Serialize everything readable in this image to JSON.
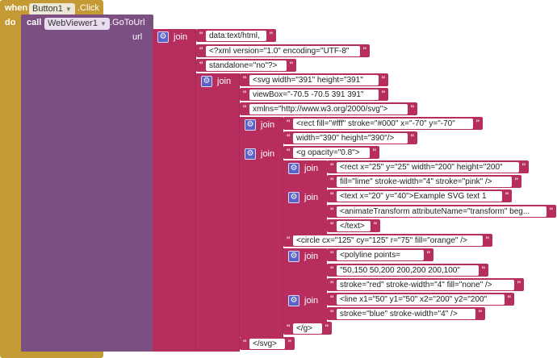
{
  "event": {
    "when": "when",
    "component": "Button1",
    "event_name": ".Click",
    "do": "do"
  },
  "call": {
    "keyword": "call",
    "component": "WebViewer1",
    "method": ".GoToUrl",
    "param": "url"
  },
  "join_label": "join",
  "strings": {
    "s01": "data:text/html,",
    "s02": "<?xml version=\"1.0\" encoding=\"UTF-8\"",
    "s03": "standalone=\"no\"?>",
    "s04": "<svg width=\"391\" height=\"391\"",
    "s05": "viewBox=\"-70.5 -70.5 391 391\"",
    "s06": "xmlns=\"http://www.w3.org/2000/svg\">",
    "s07": "<rect fill=\"#fff\" stroke=\"#000\" x=\"-70\" y=\"-70\"",
    "s08": "width=\"390\" height=\"390\"/>",
    "s09": "<g opacity=\"0.8\">",
    "s10": "<rect x=\"25\" y=\"25\" width=\"200\" height=\"200\"",
    "s11": "fill=\"lime\" stroke-width=\"4\" stroke=\"pink\" />",
    "s12": "<text x=\"20\" y=\"40\">Example SVG text 1",
    "s13": "<animateTransform attributeName=\"transform\" beg...",
    "s14": "</text>",
    "s15": "<circle cx=\"125\" cy=\"125\" r=\"75\" fill=\"orange\" />",
    "s16": "<polyline points=",
    "s17": "\"50,150 50,200 200,200 200,100\"",
    "s18": "stroke=\"red\" stroke-width=\"4\" fill=\"none\" />",
    "s19": "<line x1=\"50\" y1=\"50\" x2=\"200\" y2=\"200\"",
    "s20": "stroke=\"blue\" stroke-width=\"4\" />",
    "s21": "</g>",
    "s22": "</svg>"
  },
  "colors": {
    "event": "#c39a34",
    "component_block": "#7b4f82",
    "text_block": "#b72e5e",
    "join_gear": "#5a62c8"
  }
}
